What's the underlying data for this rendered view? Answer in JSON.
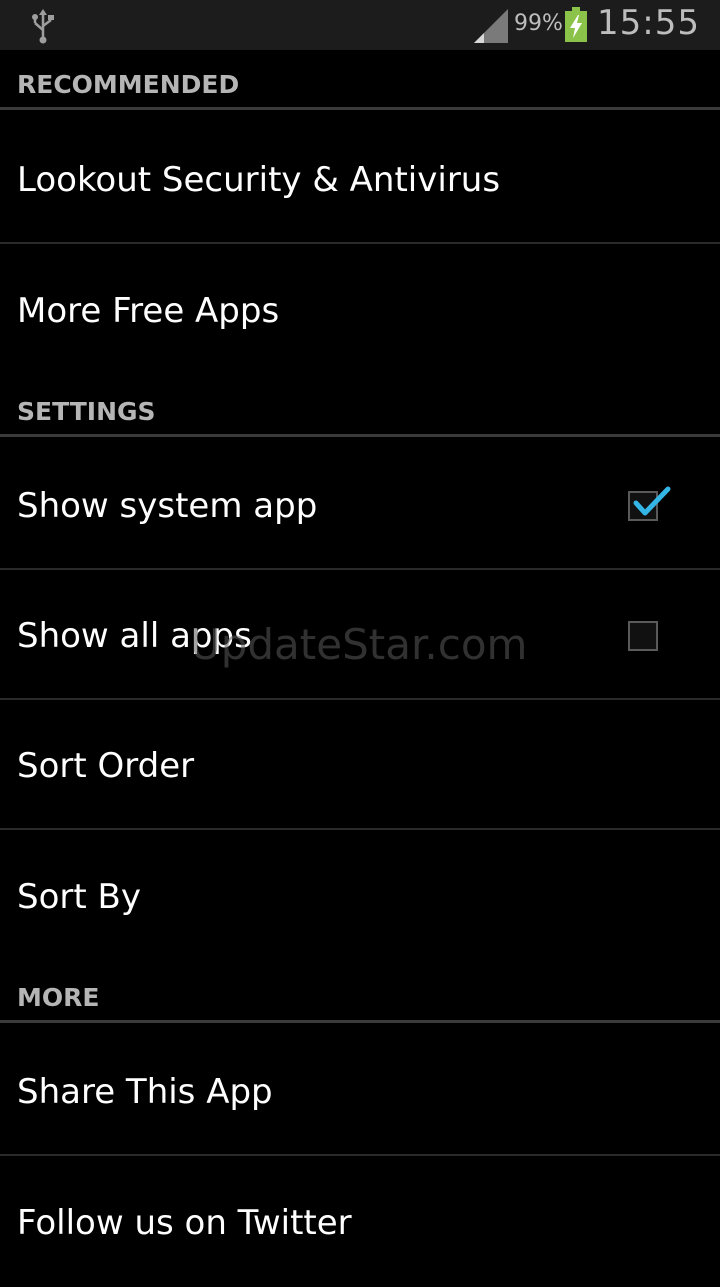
{
  "status_bar": {
    "battery_percent": "99%",
    "time": "15:55",
    "icons": [
      "usb-icon",
      "signal-icon",
      "battery-charging-icon"
    ]
  },
  "sections": {
    "recommended": {
      "header": "RECOMMENDED",
      "items": [
        "Lookout Security & Antivirus",
        "More Free Apps"
      ]
    },
    "settings": {
      "header": "SETTINGS",
      "items": [
        {
          "label": "Show system app",
          "checked": true
        },
        {
          "label": "Show all apps",
          "checked": false
        },
        {
          "label": "Sort Order"
        },
        {
          "label": "Sort By"
        }
      ]
    },
    "more": {
      "header": "MORE",
      "items": [
        "Share This App",
        "Follow us on Twitter"
      ]
    }
  },
  "watermark": "UpdateStar.com",
  "colors": {
    "background": "#000000",
    "status_bar": "#1c1c1c",
    "header_text": "#b5b5b5",
    "check_accent": "#33b5e5",
    "battery": "#8bc34a"
  }
}
